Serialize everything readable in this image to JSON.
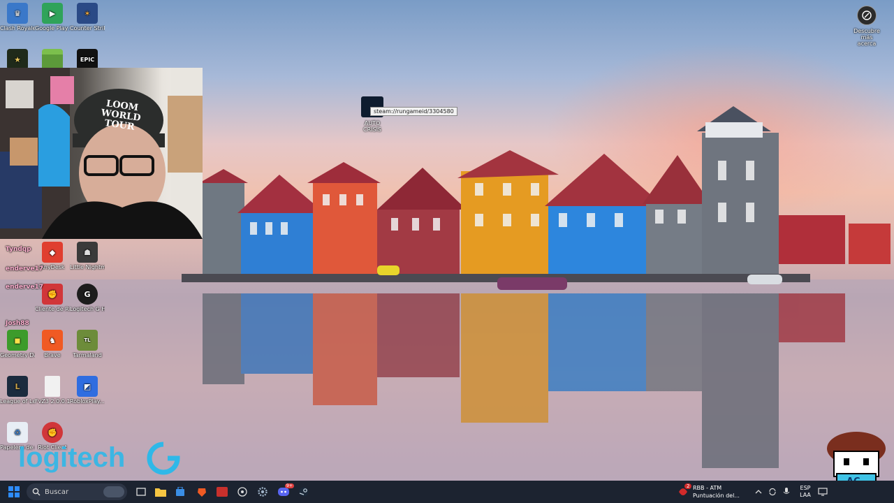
{
  "desktop": {
    "icons": [
      {
        "label": "Clash Royale",
        "icon": "clash-royale-icon",
        "color": "#3a78c9"
      },
      {
        "label": "Google Play Juegos",
        "icon": "google-play-games-icon",
        "color": "#2fa35a"
      },
      {
        "label": "Counter Strike 2",
        "icon": "counter-strike-icon",
        "color": "#2a4a86"
      },
      {
        "label": "Little Nightmares",
        "icon": "little-nightmares-icon",
        "color": "#3a3a3a"
      },
      {
        "label": "Cliente de Riot",
        "icon": "riot-client-icon",
        "color": "#d13639"
      },
      {
        "label": "Logitech G HUB",
        "icon": "logitech-ghub-icon",
        "color": "#1d1d1d"
      },
      {
        "label": "Geometry Dash",
        "icon": "geometry-dash-icon",
        "color": "#3d9b2b"
      },
      {
        "label": "Brave",
        "icon": "brave-icon",
        "color": "#f05a23"
      },
      {
        "label": "Tarmaland",
        "icon": "tarmaland-icon",
        "color": "#6d8c3a"
      },
      {
        "label": "League of Legends",
        "icon": "league-of-legends-icon",
        "color": "#1b2b3e"
      },
      {
        "label": "FvZ3 2.0.0.1.apk",
        "icon": "file-icon",
        "color": "#f1f1f1"
      },
      {
        "label": "RobloxPlay...",
        "icon": "roblox-icon",
        "color": "#2f6de0"
      },
      {
        "label": "Papelera de reciclaje",
        "icon": "recycle-bin-icon",
        "color": "#e8eef5"
      },
      {
        "label": "Riot Client",
        "icon": "riot-client-icon",
        "color": "#d13639"
      },
      {
        "label": "AnyDesk",
        "icon": "anydesk-icon",
        "color": "#e03e2f"
      },
      {
        "label": "EPIC GAMES",
        "icon": "epic-games-icon",
        "color": "#111111"
      }
    ],
    "steam_shortcut": {
      "label": "AUTO CRISIS",
      "tooltip": "steam://rungameid/3304580"
    },
    "discover": {
      "label": "Descubre más acerca"
    }
  },
  "stream_overlay": {
    "webcam_hat_text": "LOOM WORLD TOUR",
    "chat": [
      {
        "user": "Tyndqp"
      },
      {
        "user": "enderve17"
      },
      {
        "user": "enderve17"
      },
      {
        "user": "Josh88"
      }
    ],
    "logo": "logitech",
    "avatar_badge": "AC"
  },
  "taskbar": {
    "search_placeholder": "Buscar",
    "notification_title": "RBB - ATM",
    "notification_subtitle": "Puntuación del...",
    "notification_badge": "2",
    "discord_badge": "9+",
    "language": "ESP",
    "keyboard": "LAA",
    "apps": [
      "windows-start-icon",
      "search-icon",
      "task-view-icon",
      "file-explorer-icon",
      "store-icon",
      "brave-icon",
      "mefter-icon",
      "chatgpt-icon",
      "settings-icon",
      "discord-icon",
      "steam-icon"
    ]
  },
  "colors": {
    "taskbar": "#1c2330",
    "accent": "#2d8cff"
  }
}
